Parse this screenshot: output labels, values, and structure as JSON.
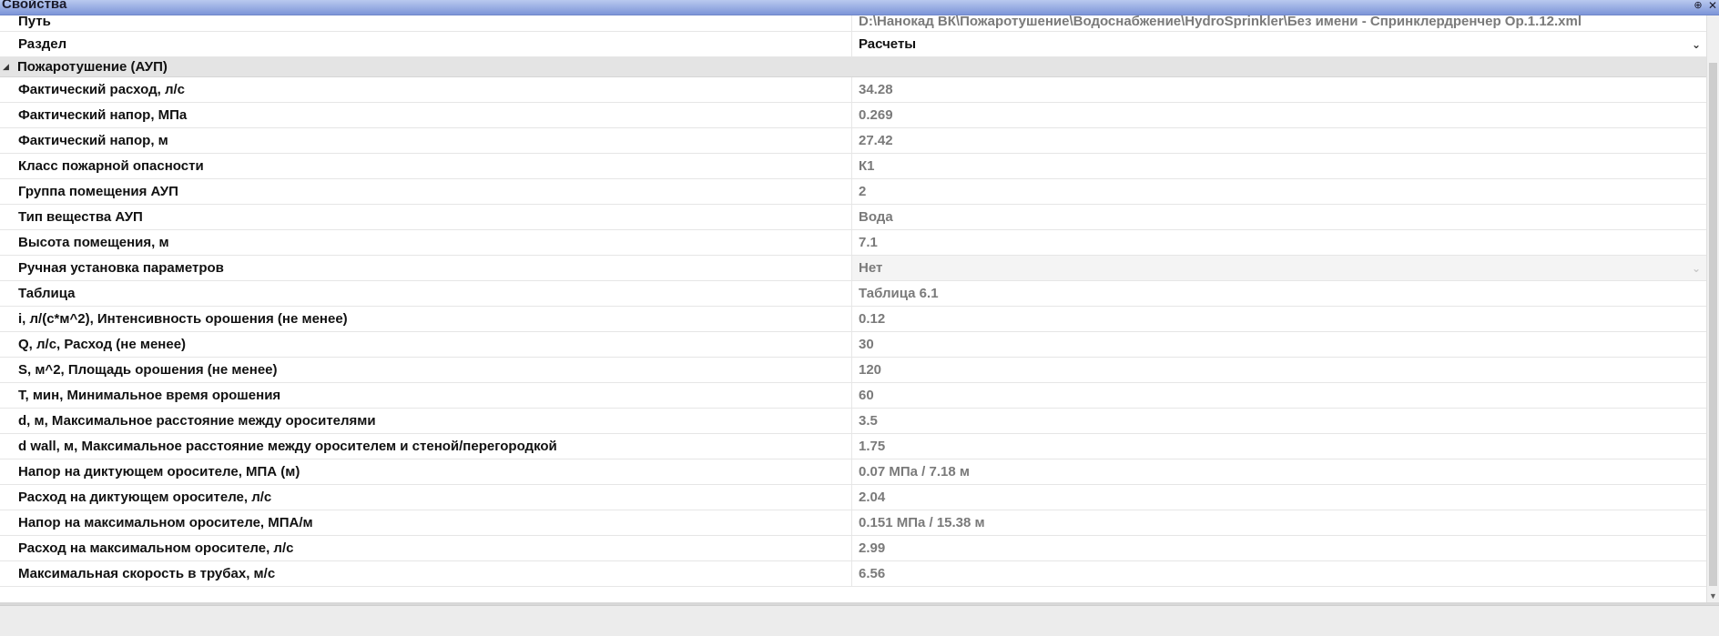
{
  "window": {
    "title": "Свойства",
    "pin_glyph": "⊕",
    "close_glyph": "✕"
  },
  "rows_top": [
    {
      "name": "Путь",
      "value": "D:\\Нанокад ВК\\Пожаротушение\\Водоснабжение\\HydroSprinkler\\Без имени - Спринклердренчер Op.1.12.xml"
    },
    {
      "name": "Раздел",
      "value": "Расчеты",
      "dropdown_glyph": "⌄"
    }
  ],
  "category": {
    "label": "Пожаротушение (АУП)",
    "toggle_glyph": "◢"
  },
  "properties": [
    {
      "name": "Фактический расход, л/с",
      "value": "34.28"
    },
    {
      "name": "Фактический напор, МПа",
      "value": "0.269"
    },
    {
      "name": "Фактический напор, м",
      "value": "27.42"
    },
    {
      "name": "Класс пожарной опасности",
      "value": "К1"
    },
    {
      "name": "Группа помещения АУП",
      "value": "2"
    },
    {
      "name": "Тип вещества АУП",
      "value": "Вода"
    },
    {
      "name": "Высота помещения, м",
      "value": "7.1"
    },
    {
      "name": "Ручная установка параметров",
      "value": "Нет",
      "dropdown_glyph": "⌄"
    },
    {
      "name": "Таблица",
      "value": "Таблица 6.1"
    },
    {
      "name": "i, л/(с*м^2), Интенсивность орошения (не менее)",
      "value": "0.12"
    },
    {
      "name": "Q, л/с, Расход (не менее)",
      "value": "30"
    },
    {
      "name": "S, м^2, Площадь орошения (не менее)",
      "value": "120"
    },
    {
      "name": "T, мин, Минимальное время орошения",
      "value": "60"
    },
    {
      "name": "d, м, Максимальное расстояние между оросителями",
      "value": "3.5"
    },
    {
      "name": "d wall, м, Максимальное расстояние между оросителем и стеной/перегородкой",
      "value": "1.75"
    },
    {
      "name": "Напор на диктующем оросителе, МПА (м)",
      "value": "0.07 МПа / 7.18 м"
    },
    {
      "name": "Расход на диктующем оросителе, л/с",
      "value": "2.04"
    },
    {
      "name": "Напор на максимальном оросителе, МПА/м",
      "value": "0.151 МПа / 15.38 м"
    },
    {
      "name": "Расход на максимальном оросителе, л/с",
      "value": "2.99"
    },
    {
      "name": "Максимальная скорость в трубах, м/с",
      "value": "6.56"
    }
  ],
  "scrollbar": {
    "down_glyph": "▼"
  }
}
